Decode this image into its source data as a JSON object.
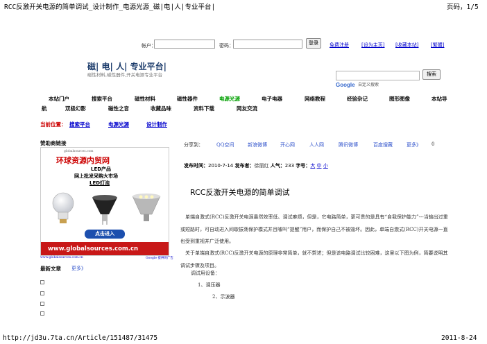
{
  "print_header": {
    "title": "RCC反激开关电源的简单调试_设计制作_电源光源_磁|电|人|专业平台|",
    "page": "页码，1/5"
  },
  "login": {
    "account_label": "帐户：",
    "password_label": "密码：",
    "login_button": "登录",
    "links": [
      "免费注册",
      "[设为主页]",
      "[收藏本站]",
      "[繁體]"
    ]
  },
  "logo": {
    "title": "磁| 电| 人| 专业平台|",
    "subtitle": "磁性材料,磁性器件,开关电源专业平台"
  },
  "search": {
    "button": "搜索",
    "google_label": "Google",
    "custom_label": "自定义搜索"
  },
  "nav": {
    "row1": [
      "本站门户",
      "搜索平台",
      "磁性材料",
      "磁性器件",
      "电源光源",
      "电子电器",
      "网络教程",
      "经验杂记",
      "图形图像",
      "本站导"
    ],
    "row2": [
      "航",
      "双极幻影",
      "磁性之音",
      "收藏品味",
      "资料下载",
      "网友交流"
    ]
  },
  "breadcrumb": {
    "label": "当前位置：",
    "items": [
      "搜索平台",
      "电源光源",
      "设计制作"
    ]
  },
  "sidebar": {
    "sponsor_title": "赞助商链接",
    "ad": {
      "top_small": "globalsources.com",
      "title": "环球资源内贸网",
      "line1": "LED产品",
      "line2": "网上批发采购大市场",
      "line3": "LED灯泡",
      "cta": "点击进入",
      "url": "www.globalsources.com.cn",
      "footer_left": "www.globalsources.com.cn",
      "footer_right": "Google 提供的广告"
    },
    "latest_title": "最新文章",
    "more": "更多》"
  },
  "share": {
    "label": "分享到：",
    "items": [
      "QQ空间",
      "新浪微博",
      "开心网",
      "人人网",
      "腾讯微博",
      "百度搜藏",
      "更多》"
    ],
    "count": "0"
  },
  "article": {
    "meta_time_label": "发布时间：",
    "meta_time": "2010-7-14",
    "meta_author_label": "发布者：",
    "meta_author": "徐丽红",
    "meta_views_label": "人气：",
    "meta_views": "233",
    "meta_size_label": "字号：",
    "meta_sizes": [
      "大",
      "中",
      "小"
    ],
    "title": "RCC反激开关电源的简单调试",
    "para1": "　单端自激式(RCC)反激开关电源虽然效率低、调试麻烦，但是，它电路简单，更可贵的是具有“自我保护能力”---当输出过重或短路时，可自动进入间歇振荡保护模式并且噱叫“提醒”用户，而保护自己不被毁坏。因此，单端自激式(RCC)开关电源一直也受到重视并广泛使用。",
    "para2": "　关于单端自激式(RCC)反激开关电源的原理非常简单，就不赘述；但是该电路调试比较困难，这里以下图为例，简要说明其调试步骤及项目。",
    "equip_title": "调试用设备：",
    "equip1": "1、调压器",
    "equip2": "2、示波器"
  },
  "print_footer": {
    "url": "http://jd3u.7ta.cn/Article/151487/31475",
    "date": "2011-8-24"
  }
}
